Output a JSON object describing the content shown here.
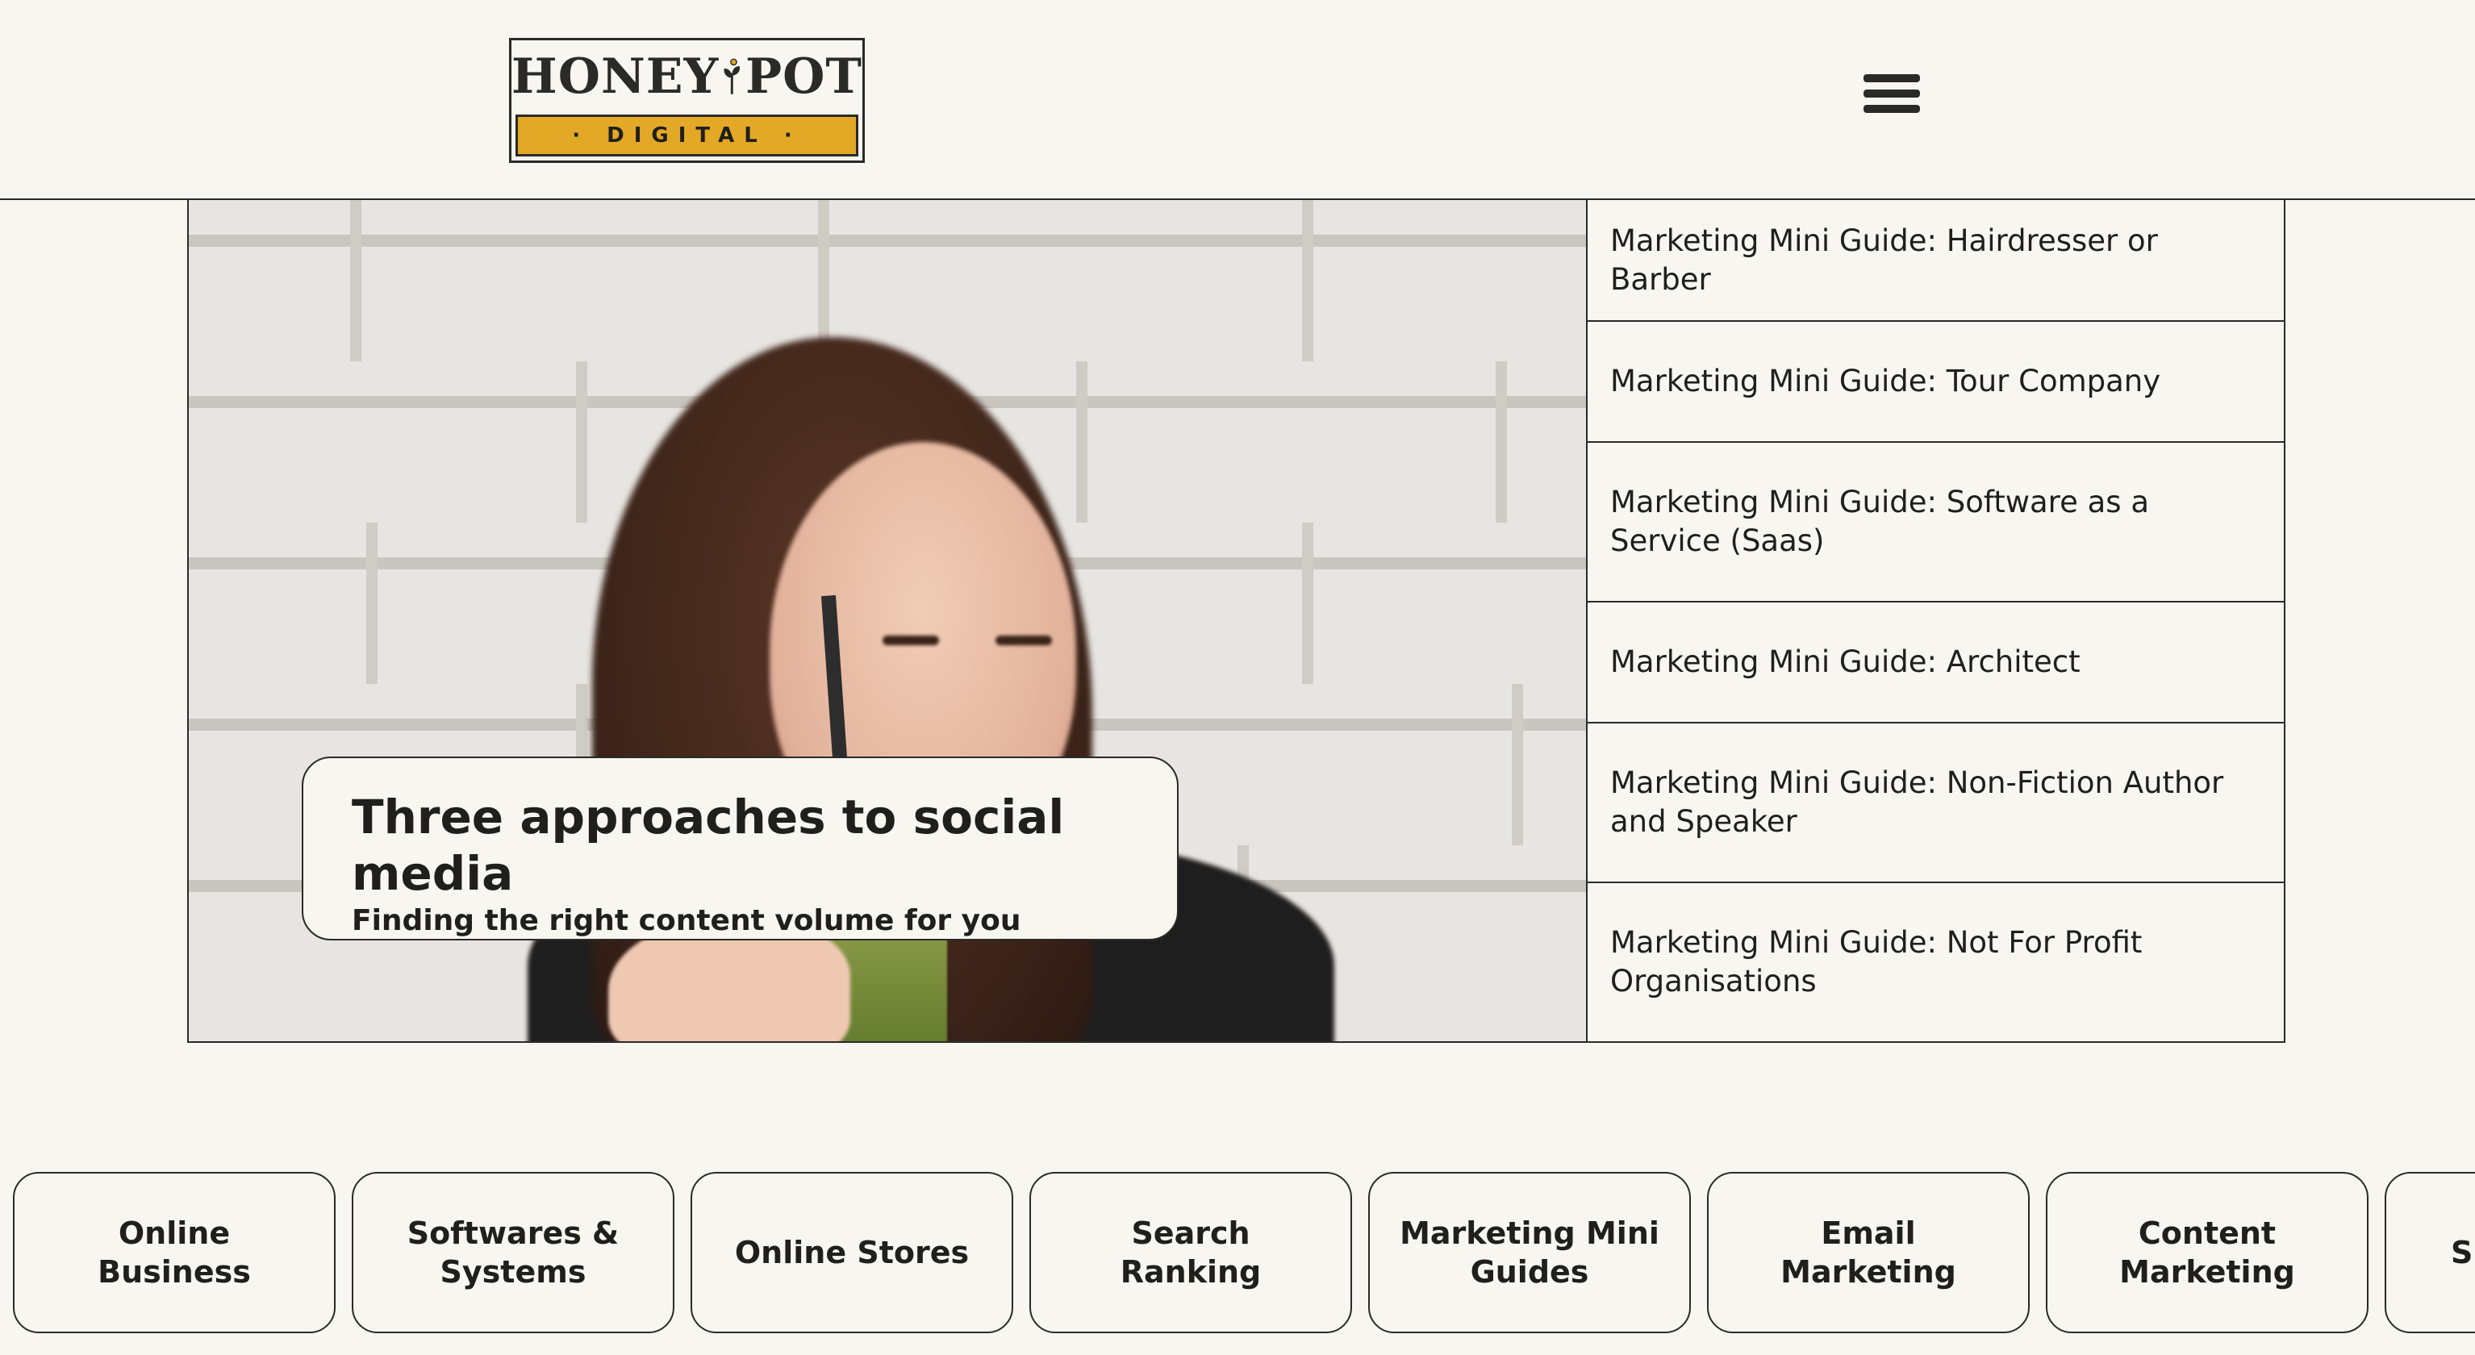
{
  "brand": {
    "logo_word_left": "HONEY",
    "logo_word_right": "POT",
    "logo_sub": "· DIGITAL ·",
    "colors": {
      "gold": "#e3a826",
      "ink": "#2a2a26",
      "background": "#f7f6f1"
    }
  },
  "header": {
    "menu_icon": "hamburger-menu-icon"
  },
  "hero": {
    "caption_title": "Three approaches to social media",
    "caption_subtitle": "Finding the right content volume for you"
  },
  "guides": [
    {
      "label": "Marketing Mini Guide: Hairdresser or Barber"
    },
    {
      "label": "Marketing Mini Guide: Tour Company"
    },
    {
      "label": "Marketing Mini Guide: Software as a Service (Saas)"
    },
    {
      "label": "Marketing Mini Guide: Architect"
    },
    {
      "label": "Marketing Mini Guide: Non-Fiction Author and Speaker"
    },
    {
      "label": "Marketing Mini Guide: Not For Profit Organisations"
    }
  ],
  "categories": [
    {
      "label": "Online\nBusiness"
    },
    {
      "label": "Softwares &\nSystems"
    },
    {
      "label": "Online Stores"
    },
    {
      "label": "Search\nRanking"
    },
    {
      "label": "Marketing Mini\nGuides"
    },
    {
      "label": "Email\nMarketing"
    },
    {
      "label": "Content\nMarketing"
    },
    {
      "label": "S"
    }
  ]
}
